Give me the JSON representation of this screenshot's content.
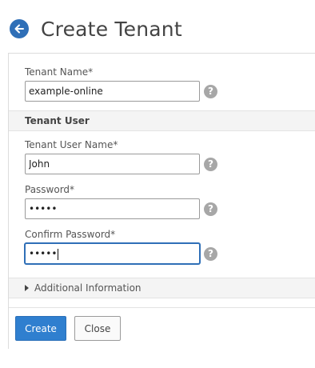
{
  "header": {
    "title": "Create Tenant",
    "back_icon": "arrow-left-circle-icon",
    "accent": "#2f6fb7"
  },
  "form": {
    "tenant_name": {
      "label": "Tenant Name*",
      "value": "example-online"
    },
    "tenant_user_section": {
      "title": "Tenant User"
    },
    "tenant_user_name": {
      "label": "Tenant User Name*",
      "value": "John"
    },
    "password": {
      "label": "Password*",
      "value": "•••••"
    },
    "confirm_password": {
      "label": "Confirm Password*",
      "value": "•••••"
    },
    "help_glyph": "?",
    "additional_information": {
      "label": "Additional Information",
      "expanded": false
    }
  },
  "actions": {
    "create_label": "Create",
    "close_label": "Close"
  }
}
